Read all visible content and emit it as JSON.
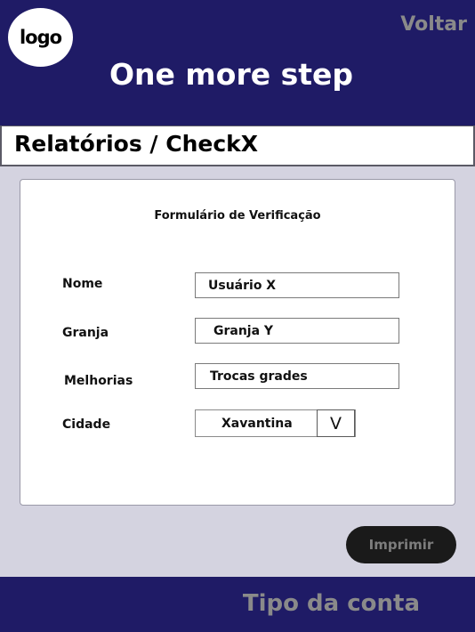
{
  "header": {
    "logo_text": "logo",
    "back_label": "Voltar",
    "title": "One more step"
  },
  "breadcrumb": {
    "text": "Relatórios / CheckX"
  },
  "form": {
    "title": "Formulário de Verificação",
    "fields": [
      {
        "label": "Nome",
        "value": "Usuário X"
      },
      {
        "label": "Granja",
        "value": "Granja Y"
      },
      {
        "label": "Melhorias",
        "value": "Trocas grades"
      }
    ],
    "city": {
      "label": "Cidade",
      "value": "Xavantina",
      "toggle": "V"
    }
  },
  "actions": {
    "print_label": "Imprimir"
  },
  "footer": {
    "account_label": "Tipo da conta"
  },
  "colors": {
    "primary": "#1f1b66",
    "background": "#d4d3e0",
    "muted_text": "#8a8a8a",
    "button": "#1a1a1a"
  }
}
